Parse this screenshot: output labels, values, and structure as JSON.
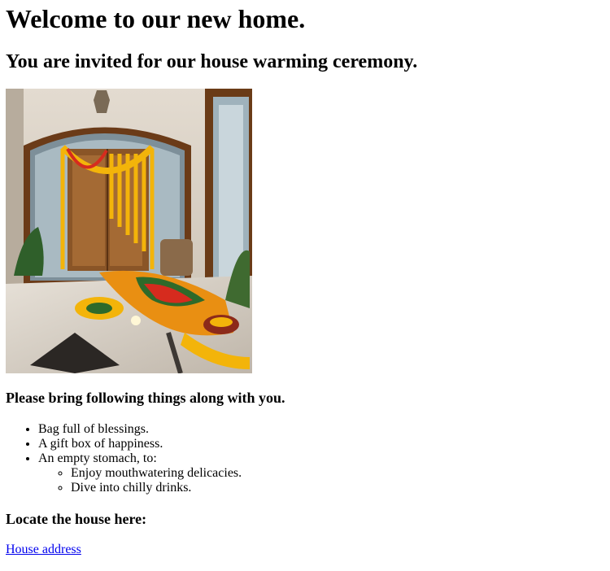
{
  "heading": "Welcome to our new home.",
  "subheading": "You are invited for our house warming ceremony.",
  "photo": {
    "icon": "decorated-entrance-photo",
    "colors": {
      "wall": "#d8cfc2",
      "wood": "#8a5527",
      "marigold": "#f3b40a",
      "floor": "#cfc7bb"
    }
  },
  "bring": {
    "heading": "Please bring following things along with you.",
    "items": [
      "Bag full of blessings.",
      "A gift box of happiness.",
      "An empty stomach, to:"
    ],
    "subitems": [
      "Enjoy mouthwatering delicacies.",
      "Dive into chilly drinks."
    ]
  },
  "locate": {
    "heading": "Locate the house here:",
    "link_label": "House address"
  }
}
